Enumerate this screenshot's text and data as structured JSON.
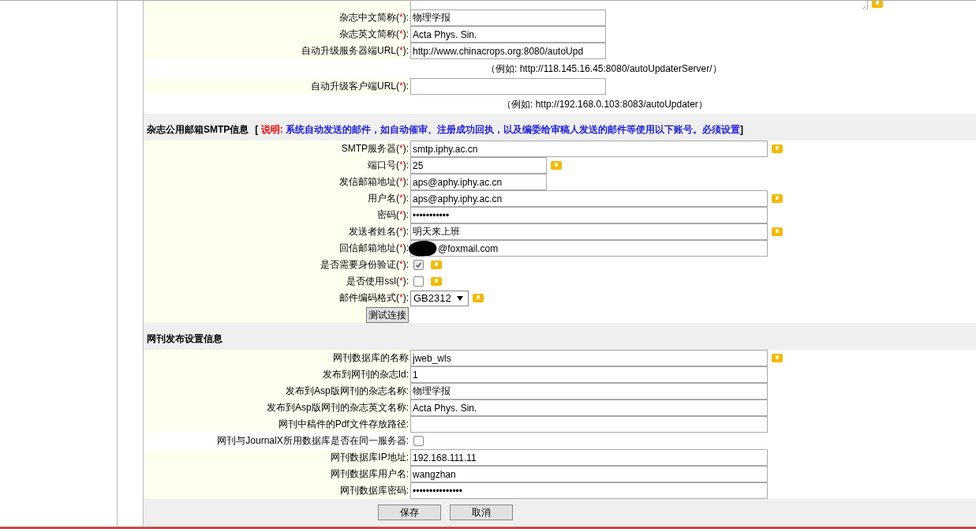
{
  "sections": [
    {
      "rows": [
        {
          "kind": "textarea",
          "help": true
        },
        {
          "kind": "text",
          "label": "杂志中文简称(",
          "required": "*",
          "suffix": "):",
          "value": "物理学报",
          "help": false
        },
        {
          "kind": "text",
          "label": "杂志英文简称(",
          "required": "*",
          "suffix": "):",
          "value": "Acta Phys. Sin.",
          "help": false
        },
        {
          "kind": "text",
          "label": "自动升级服务器端URL(",
          "required": "*",
          "suffix": "):",
          "value": "http://www.chinacrops.org:8080/autoUpd",
          "help": false
        },
        {
          "kind": "note",
          "text": "（例如: http://118.145.16.45:8080/autoUpdaterServer/）"
        },
        {
          "kind": "text",
          "label": "自动升级客户端URL(",
          "required": "*",
          "suffix": "):",
          "value": "",
          "help": false
        },
        {
          "kind": "note",
          "text": "（例如: http://192.168.0.103:8083/autoUpdater）"
        }
      ]
    },
    {
      "title": "杂志公用邮箱SMTP信息",
      "note_open": "[",
      "note_label": "说明:",
      "note_text": "系统自动发送的邮件，如自动催审、注册成功回执，以及编委给审稿人发送的邮件等使用以下账号。必须设置",
      "note_close": "]",
      "rows": [
        {
          "kind": "text",
          "label": "SMTP服务器(",
          "required": "*",
          "suffix": "):",
          "value": "smtp.iphy.ac.cn",
          "help": true
        },
        {
          "kind": "text",
          "label": "端口号(",
          "required": "*",
          "suffix": "):",
          "value": "25",
          "help": true
        },
        {
          "kind": "text",
          "label": "发信邮箱地址(",
          "required": "*",
          "suffix": "):",
          "value": "aps@aphy.iphy.ac.cn",
          "help": false
        },
        {
          "kind": "text",
          "label": "用户名(",
          "required": "*",
          "suffix": "):",
          "value": "aps@aphy.iphy.ac.cn",
          "help": true
        },
        {
          "kind": "text",
          "label": "密码(",
          "required": "*",
          "suffix": "):",
          "value": "•••••••••••",
          "help": false
        },
        {
          "kind": "text",
          "label": "发送者姓名(",
          "required": "*",
          "suffix": "):",
          "value": "明天来上班",
          "help": true
        },
        {
          "kind": "redacted",
          "label": "回信邮箱地址(",
          "required": "*",
          "suffix": "):",
          "value": "@foxmail.com",
          "help": false
        },
        {
          "kind": "checkbox",
          "label": "是否需要身份验证(",
          "required": "*",
          "suffix": "):",
          "checked": true,
          "disabled": true,
          "help": true
        },
        {
          "kind": "checkbox",
          "label": "是否使用ssl(",
          "required": "*",
          "suffix": "):",
          "checked": false,
          "disabled": false,
          "help": true
        },
        {
          "kind": "select",
          "label": "邮件编码格式(",
          "required": "*",
          "suffix": "):",
          "value": "GB2312",
          "help": true
        },
        {
          "kind": "button",
          "text": "测试连接"
        }
      ]
    },
    {
      "title": "网刊发布设置信息",
      "rows": [
        {
          "kind": "text",
          "label": "网刊数据库的名称",
          "value": "jweb_wls",
          "help": true
        },
        {
          "kind": "text",
          "label": "发布到网刊的杂志Id:",
          "value": "1",
          "help": false
        },
        {
          "kind": "text",
          "label": "发布到Asp版网刊的杂志名称:",
          "value": "物理学报",
          "help": false
        },
        {
          "kind": "text",
          "label": "发布到Asp版网刊的杂志英文名称:",
          "value": "Acta Phys. Sin.",
          "help": false
        },
        {
          "kind": "text",
          "label": "网刊中稿件的Pdf文件存放路径:",
          "value": "",
          "help": false
        },
        {
          "kind": "checkbox",
          "plain": true,
          "label": "网刊与JournalX所用数据库是否在同一服务器:",
          "checked": false,
          "disabled": false,
          "help": false
        },
        {
          "kind": "text",
          "label": "网刊数据库IP地址:",
          "value": "192.168.111.11",
          "help": false
        },
        {
          "kind": "text",
          "label": "网刊数据库用户名:",
          "value": "wangzhan",
          "help": false
        },
        {
          "kind": "text",
          "label": "网刊数据库密码:",
          "value": "•••••••••••••••",
          "help": false
        }
      ]
    }
  ],
  "actions": [
    "保存",
    "取消"
  ]
}
